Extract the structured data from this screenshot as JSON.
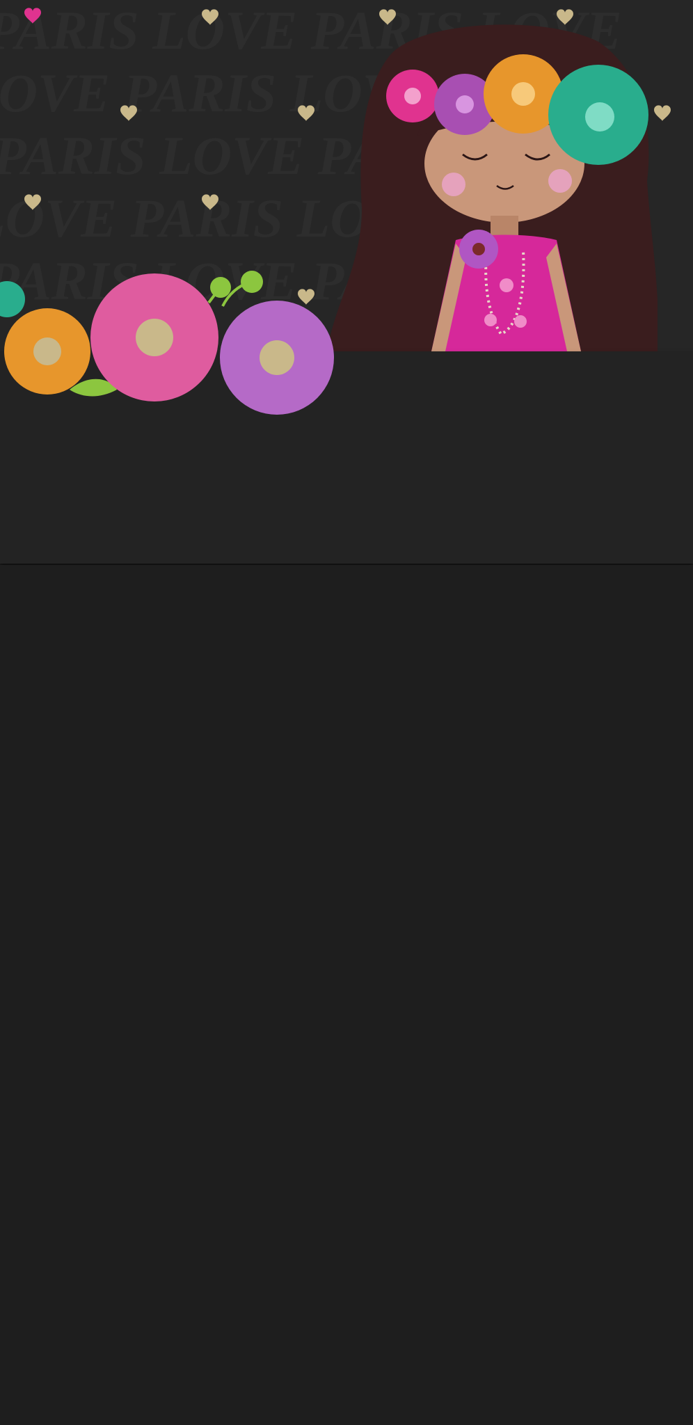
{
  "wallpaper": {
    "description_icons": [
      "heart-icon",
      "flower-icon",
      "girl-illustration"
    ],
    "colors": {
      "background": "#262626",
      "pattern_text": "#2f2f2f",
      "heart_gold": "#c9b88a",
      "heart_pink": "#e0338f",
      "hair": "#3a1d1e",
      "skin": "#c9977a",
      "dress": "#d6289a",
      "flower_pink": "#e0338f",
      "flower_purple": "#a84fb2",
      "flower_orange": "#e7962c",
      "flower_teal": "#29ad8d",
      "flower_rose": "#df5c9f",
      "flower_lilac": "#b56ac7",
      "leaf_green": "#8cc63f"
    }
  },
  "panel": {
    "color": "#232323"
  },
  "page": {
    "background": "#1e1e1e"
  }
}
